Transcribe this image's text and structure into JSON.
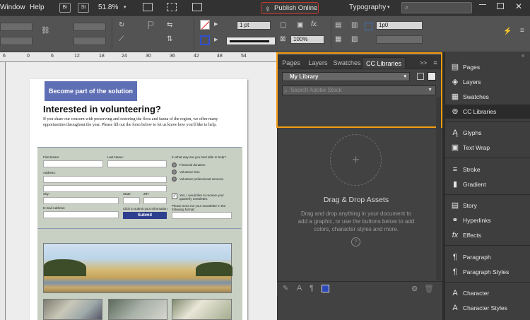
{
  "menubar": {
    "window": "Window",
    "help": "Help",
    "br_badge": "Br",
    "st_badge": "St",
    "zoom": "51.8%",
    "publish_online": "Publish Online",
    "workspace": "Typography"
  },
  "controlbar": {
    "stroke_weight": "1 pt",
    "opacity": "100%",
    "offset": "1p0"
  },
  "ruler_marks": [
    "6",
    "0",
    "6",
    "12",
    "18",
    "24",
    "30",
    "36",
    "42",
    "48",
    "54"
  ],
  "document": {
    "banner": "Become part of the solution",
    "headline": "Interested in volunteering?",
    "intro": "If you share our concern with preserving and restoring the flora and fauna of the region, we offer many opportunities throughout the year. Please fill out the form below to let us know how you'd like to help.",
    "form": {
      "first_name": "First Name:",
      "last_name": "Last Name:",
      "address": "Address:",
      "city": "City:",
      "state": "State:",
      "zip": "ZIP:",
      "email": "E-mail Address:",
      "click_submit": "Click to submit your information",
      "help_question": "In what way are you best able to help?",
      "options": [
        "Financial donation",
        "Volunteer time",
        "Volunteer professional services"
      ],
      "newsletter_check": "Yes, I would like to receive your quarterly newsletter.",
      "newsletter_format": "Please send me your newsletter in the following format:",
      "submit": "Submit"
    }
  },
  "libraries_panel": {
    "tabs": [
      "Pages",
      "Layers",
      "Swatches",
      "CC Libraries"
    ],
    "overflow": ">>",
    "library_name": "My Library",
    "search_placeholder": "Search Adobe Stock",
    "drop_plus": "+",
    "drop_title": "Drag & Drop Assets",
    "drop_desc": "Drag and drop anything in your document to add a graphic, or use the buttons below to add colors, character styles and more.",
    "help": "?"
  },
  "dock": {
    "items": [
      "Pages",
      "Layers",
      "Swatches",
      "CC Libraries",
      "Glyphs",
      "Text Wrap",
      "Stroke",
      "Gradient",
      "Story",
      "Hyperlinks",
      "Effects",
      "Paragraph",
      "Paragraph Styles",
      "Character",
      "Character Styles"
    ]
  },
  "colors": {
    "accent_orange": "#f39c12",
    "publish_border": "#c0392b",
    "banner_blue": "#5f6fb5"
  }
}
